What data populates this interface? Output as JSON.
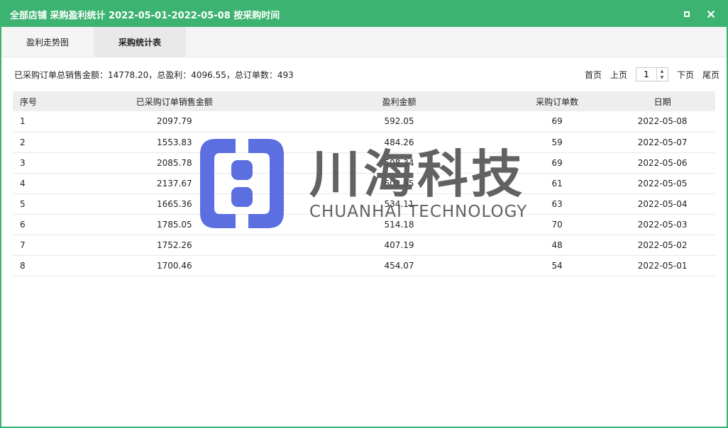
{
  "window": {
    "title": "全部店铺 采购盈利统计 2022-05-01-2022-05-08 按采购时间"
  },
  "tabs": [
    {
      "label": "盈利走势图",
      "active": false
    },
    {
      "label": "采购统计表",
      "active": true
    }
  ],
  "summary": {
    "text": "已采购订单总销售金额：14778.20，总盈利：4096.55，总订单数：493"
  },
  "pager": {
    "first": "首页",
    "prev": "上页",
    "page": "1",
    "next": "下页",
    "last": "尾页"
  },
  "table": {
    "headers": [
      "序号",
      "已采购订单销售金额",
      "盈利金额",
      "采购订单数",
      "日期"
    ],
    "rows": [
      [
        "1",
        "2097.79",
        "592.05",
        "69",
        "2022-05-08"
      ],
      [
        "2",
        "1553.83",
        "484.26",
        "59",
        "2022-05-07"
      ],
      [
        "3",
        "2085.78",
        "508.34",
        "69",
        "2022-05-06"
      ],
      [
        "4",
        "2137.67",
        "602.35",
        "61",
        "2022-05-05"
      ],
      [
        "5",
        "1665.36",
        "534.11",
        "63",
        "2022-05-04"
      ],
      [
        "6",
        "1785.05",
        "514.18",
        "70",
        "2022-05-03"
      ],
      [
        "7",
        "1752.26",
        "407.19",
        "48",
        "2022-05-02"
      ],
      [
        "8",
        "1700.46",
        "454.07",
        "54",
        "2022-05-01"
      ]
    ]
  },
  "watermark": {
    "cn": "川海科技",
    "en": "CHUANHAI TECHNOLOGY",
    "logo_color": "#5b6fe0"
  },
  "colors": {
    "accent": "#3cb371"
  }
}
